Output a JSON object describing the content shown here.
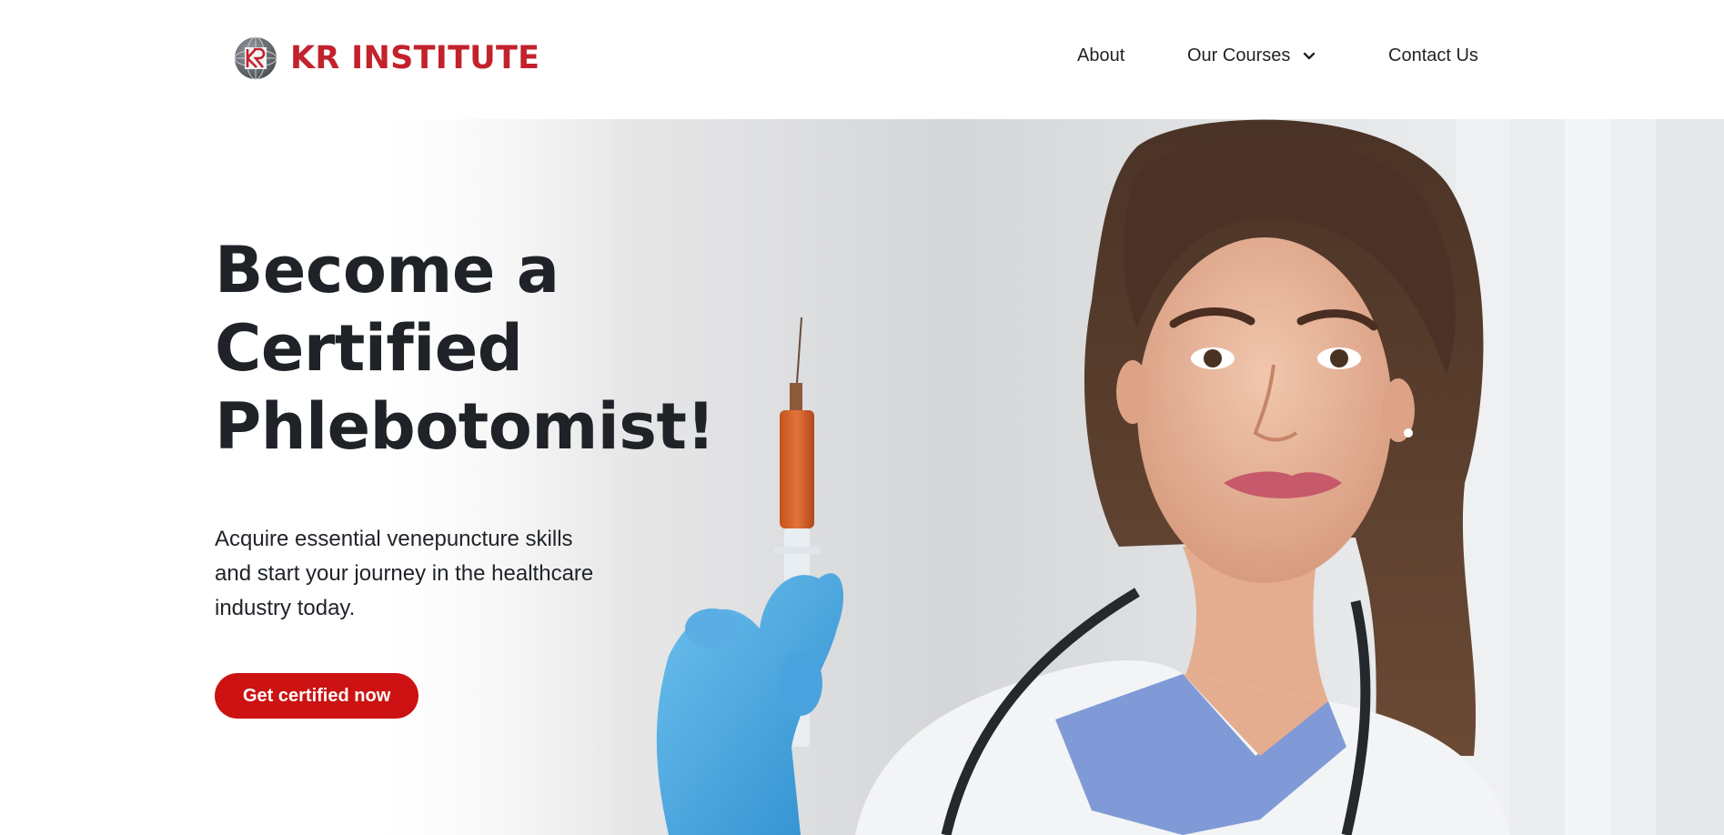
{
  "brand": {
    "name": "KR INSTITUTE",
    "logo_mark_text": "KR",
    "color": "#c3222c",
    "logo_icon": "globe-kr-icon"
  },
  "nav": {
    "about": "About",
    "courses": "Our Courses",
    "courses_icon": "chevron-down-icon",
    "contact": "Contact Us"
  },
  "hero": {
    "headline_line1": "Become a Certified",
    "headline_line2": "Phlebotomist!",
    "subtext": "Acquire essential venepuncture skills and start your journey in the healthcare industry today.",
    "cta_label": "Get certified now",
    "cta_color": "#cc1212",
    "image_subject": "nurse-holding-syringe-image"
  }
}
